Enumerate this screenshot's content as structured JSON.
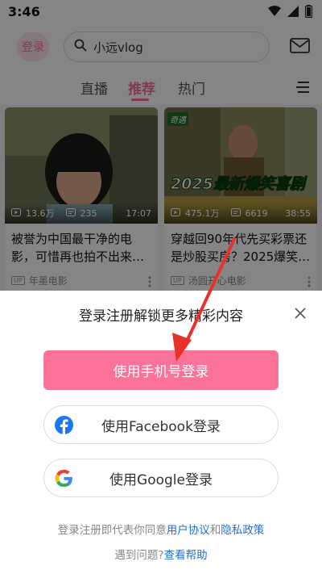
{
  "status_bar": {
    "time": "3:46"
  },
  "header": {
    "login_label": "登录",
    "search_text": "小远vlog"
  },
  "tabs": [
    {
      "label": "直播"
    },
    {
      "label": "推荐"
    },
    {
      "label": "热门"
    }
  ],
  "cards": [
    {
      "views": "13.6万",
      "comments": "235",
      "duration": "17:07",
      "title": "被誉为中国最干净的电影，可惜再也拍不出来…",
      "author": "年墨电影"
    },
    {
      "badge": "奇遇",
      "banner_top": "2025",
      "banner_mid": "最新",
      "banner_end": "爆笑喜剧",
      "views": "475.1万",
      "comments": "6619",
      "duration": "38:55",
      "title": "穿越回90年代先买彩票还是炒股买房？2025爆笑…",
      "author": "汤圆开心电影"
    }
  ],
  "up_badge": "UP",
  "login_sheet": {
    "title": "登录注册解锁更多精彩内容",
    "phone_button": "使用手机号登录",
    "facebook_button": "使用Facebook登录",
    "google_button": "使用Google登录",
    "terms_prefix": "登录注册即代表你同意",
    "terms_link_user": "用户协议",
    "terms_and": "和",
    "terms_link_privacy": "隐私政策",
    "help_prefix": "遇到问题?",
    "help_link": "查看帮助"
  },
  "colors": {
    "accent": "#fb7299",
    "link": "#1e6fd9",
    "arrow": "#e8312a",
    "facebook": "#1877f2"
  },
  "icons": [
    "wifi-icon",
    "signal-icon",
    "battery-icon",
    "search-icon",
    "mail-icon",
    "menu-icon",
    "play-icon",
    "comment-icon",
    "more-icon",
    "close-icon",
    "facebook-icon",
    "google-icon"
  ]
}
